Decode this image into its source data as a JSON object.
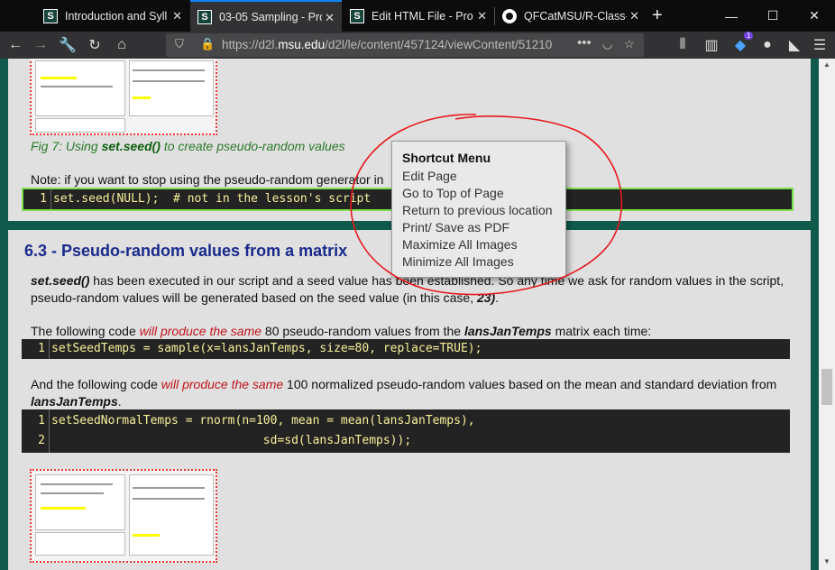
{
  "browser": {
    "tabs": [
      {
        "label": "Introduction and Syll",
        "active": false,
        "icon": "msu-icon"
      },
      {
        "label": "03-05 Sampling - Pro",
        "active": true,
        "icon": "msu-icon"
      },
      {
        "label": "Edit HTML File - Pro",
        "active": false,
        "icon": "msu-icon"
      },
      {
        "label": "QFCatMSU/R-Class-",
        "active": false,
        "icon": "github-icon"
      }
    ],
    "url_host": "https://d2l.",
    "url_domain": "msu.edu",
    "url_path": "/d2l/le/content/457124/viewContent/51210",
    "notification_count": "1"
  },
  "page": {
    "fig7_caption_prefix": "Fig 7: Using ",
    "fig7_caption_code": "set.seed()",
    "fig7_caption_suffix": " to create pseudo-random values",
    "note_text": "Note: if you want to stop using the pseudo-random generator in",
    "code1": {
      "num": "1",
      "src": "set.seed(NULL);  # not in the lesson's script"
    },
    "section_title": "6.3 - Pseudo-random values from a matrix",
    "para1_code": "set.seed()",
    "para1_a": " has been executed in our script and a seed value has been established. So any time we ask for random values in the script,",
    "para1_b": "pseudo-random values will be generated based on the seed value (in this case, ",
    "para1_seed": "23)",
    "para1_end": ".",
    "para2_a": "The following code ",
    "para2_red": "will produce the same",
    "para2_b": " 80 pseudo-random values from the ",
    "para2_var": "lansJanTemps",
    "para2_c": " matrix each time:",
    "code2": {
      "num": "1",
      "src": "setSeedTemps = sample(x=lansJanTemps, size=80, replace=TRUE);"
    },
    "para3_a": "And the following code ",
    "para3_red": "will produce the same",
    "para3_b": " 100 normalized pseudo-random values based on the mean and standard deviation from",
    "para3_var": "lansJanTemps",
    "para3_end": ".",
    "code3": [
      {
        "num": "1",
        "src": "setSeedNormalTemps = rnorm(n=100, mean = mean(lansJanTemps),"
      },
      {
        "num": "2",
        "src": "                              sd=sd(lansJanTemps));"
      }
    ]
  },
  "shortcut_menu": {
    "title": "Shortcut Menu",
    "items": [
      "Edit Page",
      "Go to Top of Page",
      "Return to previous location",
      "Print/ Save as PDF",
      "Maximize All Images",
      "Minimize All Images"
    ]
  }
}
